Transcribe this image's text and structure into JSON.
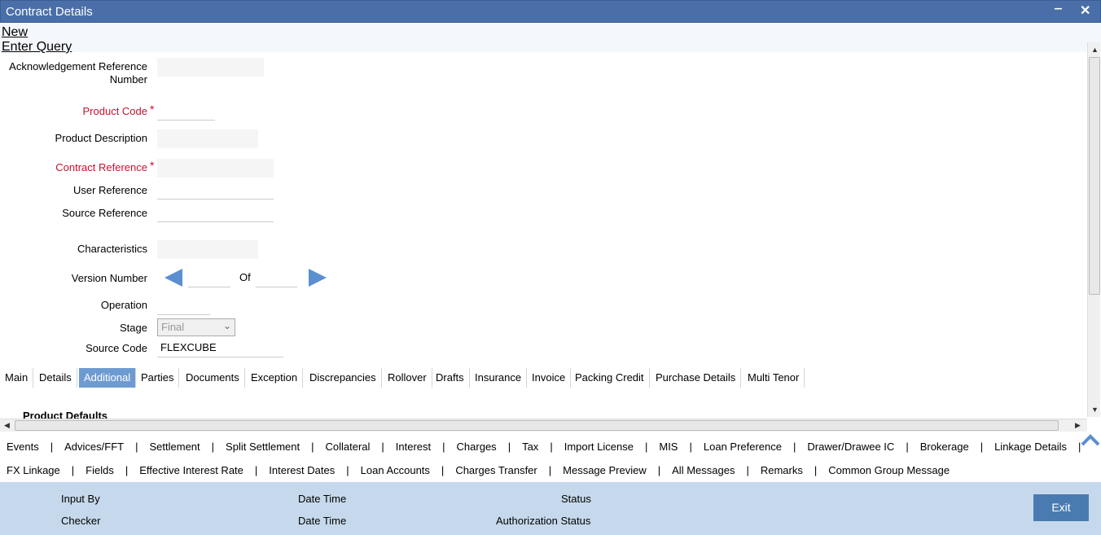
{
  "window": {
    "title": "Contract Details"
  },
  "menu": {
    "new": "New",
    "enter_query": "Enter Query"
  },
  "form": {
    "ack_ref_label": "Acknowledgement Reference Number",
    "product_code_label": "Product Code",
    "product_desc_label": "Product Description",
    "contract_ref_label": "Contract Reference",
    "user_ref_label": "User Reference",
    "source_ref_label": "Source Reference",
    "characteristics_label": "Characteristics",
    "version_label": "Version Number",
    "of_label": "Of",
    "operation_label": "Operation",
    "stage_label": "Stage",
    "stage_value": "Final",
    "source_code_label": "Source Code",
    "source_code_value": "FLEXCUBE",
    "required_mark": "*"
  },
  "tabs": [
    "Main",
    "Details",
    "Additional",
    "Parties",
    "Documents",
    "Exception",
    "Discrepancies",
    "Rollover",
    "Drafts",
    "Insurance",
    "Invoice",
    "Packing Credit",
    "Purchase Details",
    "Multi Tenor"
  ],
  "active_tab": "Additional",
  "section_title": "Product Defaults",
  "links_row1": [
    "Events",
    "Advices/FFT",
    "Settlement",
    "Split Settlement",
    "Collateral",
    "Interest",
    "Charges",
    "Tax",
    "Import License",
    "MIS",
    "Loan Preference",
    "Drawer/Drawee IC",
    "Brokerage",
    "Linkage Details"
  ],
  "links_row2": [
    "FX Linkage",
    "Fields",
    "Effective Interest Rate",
    "Interest Dates",
    "Loan Accounts",
    "Charges Transfer",
    "Message Preview",
    "All Messages",
    "Remarks",
    "Common Group Message"
  ],
  "footer": {
    "input_by": "Input By",
    "date_time_1": "Date Time",
    "status": "Status",
    "checker": "Checker",
    "date_time_2": "Date Time",
    "auth_status": "Authorization Status",
    "exit": "Exit"
  },
  "colors": {
    "titlebar": "#4a6fa8",
    "active_tab": "#6d9bd1",
    "required": "#c8102e",
    "footer": "#c6d9ec",
    "exit_button": "#4a7bb0"
  },
  "icons": [
    "minimize-icon",
    "close-icon",
    "prev-version-icon",
    "next-version-icon",
    "dropdown-chevron-icon",
    "scroll-up-icon"
  ]
}
